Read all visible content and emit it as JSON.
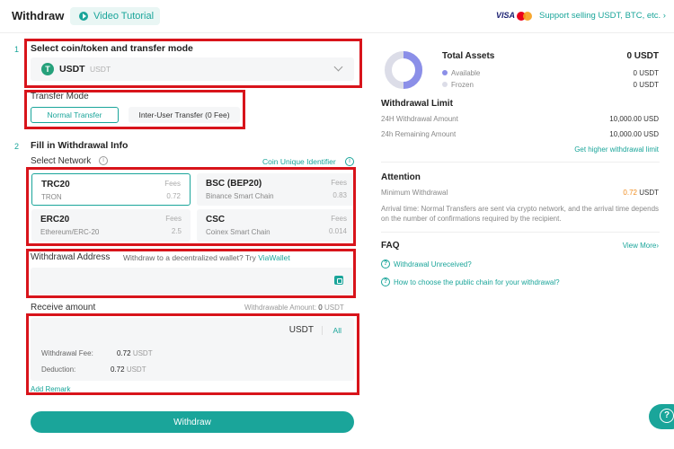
{
  "header": {
    "title": "Withdraw",
    "video_tutorial": "Video Tutorial",
    "visa": "VISA",
    "support_link": "Support selling USDT, BTC, etc. ›"
  },
  "step1": {
    "number": "1",
    "title": "Select coin/token and transfer mode",
    "coin": {
      "icon": "T",
      "symbol": "USDT",
      "name": "USDT"
    }
  },
  "transfer_mode": {
    "label": "Transfer Mode",
    "options": [
      "Normal Transfer",
      "Inter-User Transfer (0 Fee)"
    ],
    "selected": "Normal Transfer"
  },
  "step2": {
    "number": "2",
    "title": "Fill in Withdrawal Info"
  },
  "network": {
    "label": "Select Network",
    "info_icon": "i",
    "coin_identifier": "Coin Unique Identifier",
    "fees_label": "Fees",
    "options": [
      {
        "name": "TRC20",
        "sub": "TRON",
        "fee": "0.72"
      },
      {
        "name": "BSC (BEP20)",
        "sub": "Binance Smart Chain",
        "fee": "0.83"
      },
      {
        "name": "ERC20",
        "sub": "Ethereum/ERC-20",
        "fee": "2.5"
      },
      {
        "name": "CSC",
        "sub": "Coinex Smart Chain",
        "fee": "0.014"
      }
    ]
  },
  "address": {
    "label": "Withdrawal Address",
    "hint": "Withdraw to a decentralized wallet? Try",
    "hint_link": "ViaWallet",
    "placeholder": ""
  },
  "receive": {
    "label": "Receive amount",
    "withdrawable_label": "Withdrawable Amount:",
    "withdrawable_value": "0",
    "withdrawable_unit": "USDT",
    "currency": "USDT",
    "all": "All",
    "fee_label": "Withdrawal Fee:",
    "fee_value": "0.72",
    "fee_unit": "USDT",
    "deduction_label": "Deduction:",
    "deduction_value": "0.72",
    "deduction_unit": "USDT",
    "add_remark": "Add Remark"
  },
  "withdraw_button": "Withdraw",
  "assets": {
    "title": "Total Assets",
    "total": "0 USDT",
    "available_label": "Available",
    "available_value": "0 USDT",
    "frozen_label": "Frozen",
    "frozen_value": "0 USDT",
    "available_color": "#8b8fe8",
    "frozen_color": "#dcdde8"
  },
  "limit": {
    "title": "Withdrawal Limit",
    "rows": [
      {
        "label": "24H Withdrawal Amount",
        "value": "10,000.00 USD"
      },
      {
        "label": "24h Remaining Amount",
        "value": "10,000.00 USD"
      }
    ],
    "higher_link": "Get higher withdrawal limit"
  },
  "attention": {
    "title": "Attention",
    "min_label": "Minimum Withdrawal",
    "min_value": "0.72",
    "min_unit": "USDT",
    "arrival_text": "Arrival time: Normal Transfers are sent via crypto network, and the arrival time depends on the number of confirmations required by the recipient."
  },
  "faq": {
    "title": "FAQ",
    "view_more": "View More›",
    "items": [
      "Withdrawal Unreceived?",
      "How to choose the public chain for your withdrawal?"
    ]
  },
  "colors": {
    "accent": "#1aa59a",
    "highlight_box": "#d8141b",
    "min_value": "#f08c1e"
  }
}
